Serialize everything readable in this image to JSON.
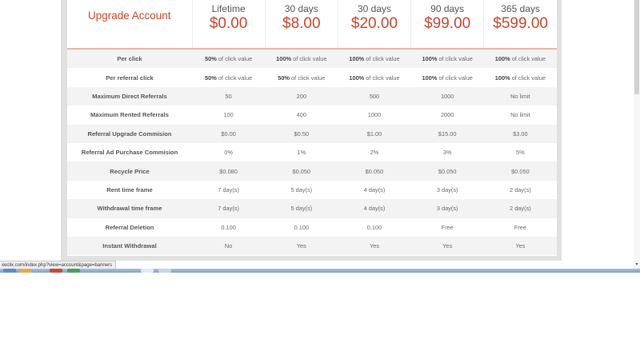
{
  "header": {
    "title": "Upgrade Account",
    "plans": [
      {
        "duration": "Lifetime",
        "price": "$0.00"
      },
      {
        "duration": "30 days",
        "price": "$8.00"
      },
      {
        "duration": "30 days",
        "price": "$20.00"
      },
      {
        "duration": "90 days",
        "price": "$99.00"
      },
      {
        "duration": "365 days",
        "price": "$599.00"
      }
    ]
  },
  "rows": [
    {
      "label": "Per click",
      "values": [
        {
          "bold": "50%",
          "rest": " of click value"
        },
        {
          "bold": "100%",
          "rest": " of click value"
        },
        {
          "bold": "100%",
          "rest": " of click value"
        },
        {
          "bold": "100%",
          "rest": " of click value"
        },
        {
          "bold": "100%",
          "rest": " of click value"
        }
      ]
    },
    {
      "label": "Per referral click",
      "values": [
        {
          "bold": "50%",
          "rest": " of click value"
        },
        {
          "bold": "50%",
          "rest": " of click value"
        },
        {
          "bold": "100%",
          "rest": " of click value"
        },
        {
          "bold": "100%",
          "rest": " of click value"
        },
        {
          "bold": "100%",
          "rest": " of click value"
        }
      ]
    },
    {
      "label": "Maximum Direct Referrals",
      "values": [
        "50",
        "200",
        "500",
        "1000",
        "No limit"
      ]
    },
    {
      "label": "Maximum Rented Referrals",
      "values": [
        "100",
        "400",
        "1000",
        "2000",
        "No limit"
      ]
    },
    {
      "label": "Referral Upgrade Commision",
      "values": [
        "$0.00",
        "$0.50",
        "$1.00",
        "$15.00",
        "$3.00"
      ]
    },
    {
      "label": "Referral Ad Purchase Commision",
      "values": [
        "0%",
        "1%",
        "2%",
        "3%",
        "5%"
      ]
    },
    {
      "label": "Recycle Price",
      "values": [
        "$0.080",
        "$0.050",
        "$0.050",
        "$0.050",
        "$0.050"
      ]
    },
    {
      "label": "Rent time frame",
      "values": [
        "7 day(s)",
        "5 day(s)",
        "4 day(s)",
        "3 day(s)",
        "2 day(s)"
      ]
    },
    {
      "label": "Withdrawal time frame",
      "values": [
        "7 day(s)",
        "5 day(s)",
        "4 day(s)",
        "3 day(s)",
        "2 day(s)"
      ]
    },
    {
      "label": "Referral Deletion",
      "values": [
        "0.100",
        "0.100",
        "0.100",
        "Free",
        "Free"
      ]
    },
    {
      "label": "Instant Withdrawal",
      "values": [
        "No",
        "Yes",
        "Yes",
        "Yes",
        "Yes"
      ]
    }
  ],
  "status_bar": {
    "url": "xeclix.com/index.php?view=account&page=banners"
  },
  "scrollbar": {
    "down_arrow": "▾"
  },
  "colors": {
    "accent": "#c9452a",
    "stripe": "#f3f3f3",
    "frame": "#e1e1e1"
  }
}
